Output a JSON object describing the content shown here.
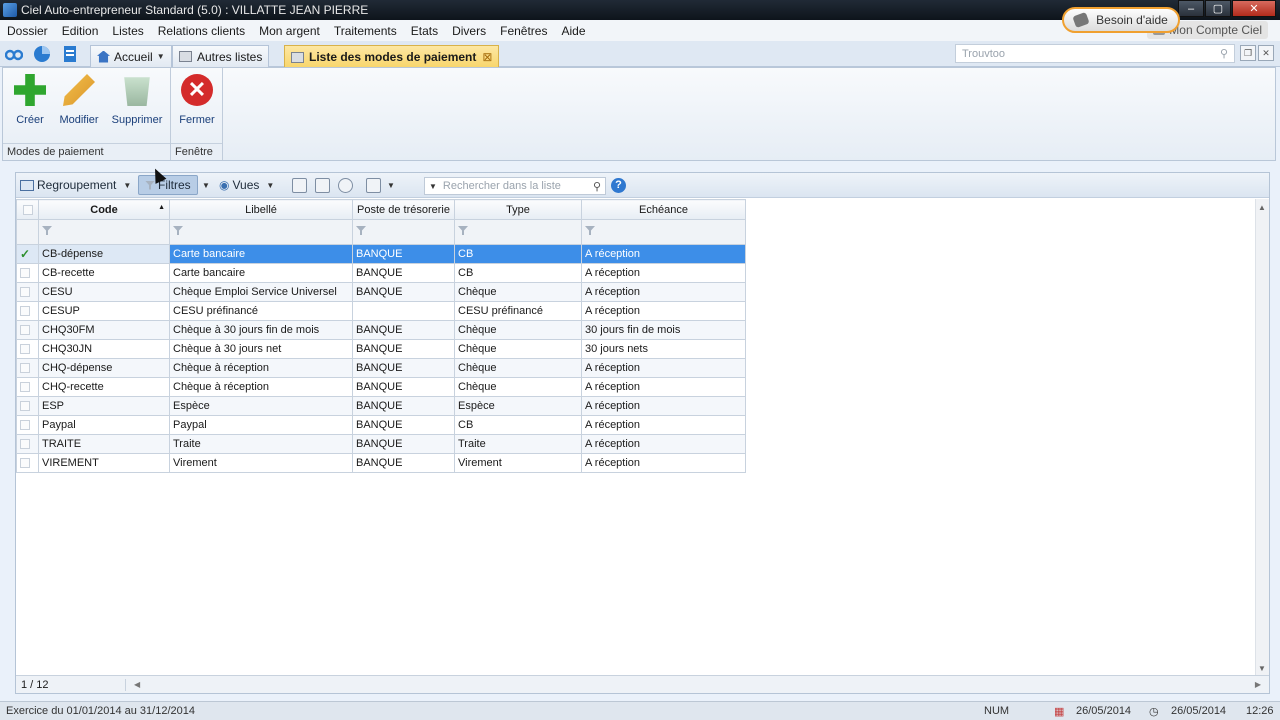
{
  "window": {
    "title": "Ciel Auto-entrepreneur Standard (5.0) : VILLATTE JEAN PIERRE",
    "help_label": "Besoin d'aide",
    "controls": [
      "–",
      "▢",
      "✕"
    ]
  },
  "menu": [
    "Dossier",
    "Edition",
    "Listes",
    "Relations clients",
    "Mon argent",
    "Traitements",
    "Etats",
    "Divers",
    "Fenêtres",
    "Aide"
  ],
  "account_label": "Mon Compte Ciel",
  "tabs": {
    "home": "Accueil",
    "other": "Autres listes",
    "active": "Liste des modes de paiement",
    "active_close": "⊠"
  },
  "top_search_placeholder": "Trouvtoo",
  "ribbon": {
    "buttons": [
      "Créer",
      "Modifier",
      "Supprimer",
      "Fermer"
    ],
    "group1": "Modes de paiement",
    "group2": "Fenêtre"
  },
  "list_toolbar": {
    "grouping": "Regroupement",
    "filters": "Filtres",
    "views": "Vues",
    "search_placeholder": "Rechercher dans la liste"
  },
  "grid": {
    "columns": [
      "Code",
      "Libellé",
      "Poste de trésorerie",
      "Type",
      "Echéance"
    ],
    "rows": [
      [
        "CB-dépense",
        "Carte bancaire",
        "BANQUE",
        "CB",
        "A réception"
      ],
      [
        "CB-recette",
        "Carte bancaire",
        "BANQUE",
        "CB",
        "A réception"
      ],
      [
        "CESU",
        "Chèque Emploi Service Universel",
        "BANQUE",
        "Chèque",
        "A réception"
      ],
      [
        "CESUP",
        "CESU préfinancé",
        "",
        "CESU préfinancé",
        "A réception"
      ],
      [
        "CHQ30FM",
        "Chèque à 30 jours fin de mois",
        "BANQUE",
        "Chèque",
        "30 jours fin de mois"
      ],
      [
        "CHQ30JN",
        "Chèque à 30 jours net",
        "BANQUE",
        "Chèque",
        "30 jours nets"
      ],
      [
        "CHQ-dépense",
        "Chèque à réception",
        "BANQUE",
        "Chèque",
        "A réception"
      ],
      [
        "CHQ-recette",
        "Chèque à réception",
        "BANQUE",
        "Chèque",
        "A réception"
      ],
      [
        "ESP",
        "Espèce",
        "BANQUE",
        "Espèce",
        "A réception"
      ],
      [
        "Paypal",
        "Paypal",
        "BANQUE",
        "CB",
        "A réception"
      ],
      [
        "TRAITE",
        "Traite",
        "BANQUE",
        "Traite",
        "A réception"
      ],
      [
        "VIREMENT",
        "Virement",
        "BANQUE",
        "Virement",
        "A réception"
      ]
    ]
  },
  "list_footer": {
    "count": "1 / 12"
  },
  "status": {
    "exercise": "Exercice du 01/01/2014 au 31/12/2014",
    "num": "NUM",
    "date1": "26/05/2014",
    "date2": "26/05/2014",
    "time": "12:26"
  }
}
